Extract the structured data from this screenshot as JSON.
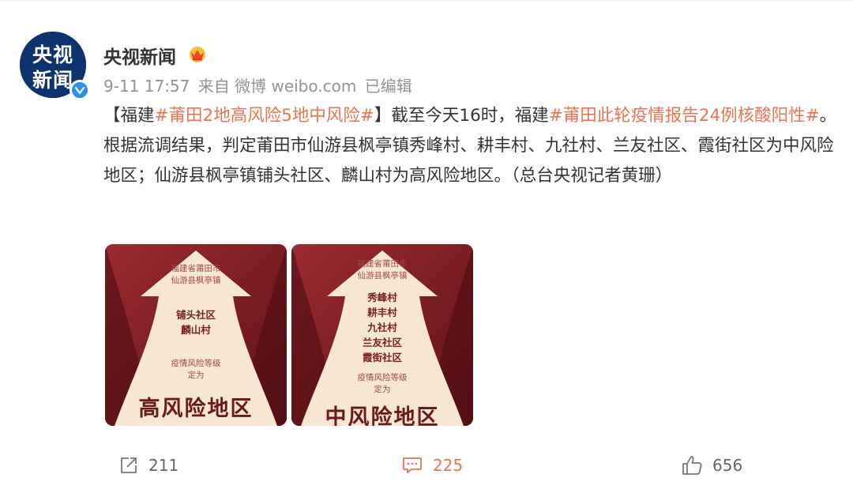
{
  "post": {
    "author": "央视新闻",
    "avatar_line1": "央视",
    "avatar_line2": "新闻",
    "time": "9-11 17:57",
    "source": "来自 微博 weibo.com",
    "edited": "已编辑",
    "text_parts": {
      "p1": "【福建",
      "tag1": "#莆田2地高风险5地中风险#",
      "p2": "】截至今天16时，福建",
      "tag2": "#莆田此轮疫情报告24例核酸阳性#",
      "p3": "。根据流调结果，判定莆田市仙游县枫亭镇秀峰村、耕丰村、九社村、兰友社区、霞街社区为中风险地区；仙游县枫亭镇铺头社区、麟山村为高风险地区。（总台央视记者黄珊）"
    }
  },
  "images": [
    {
      "location_line1": "福建省莆田市",
      "location_line2": "仙游县枫亭镇",
      "names": [
        "铺头社区",
        "麟山村"
      ],
      "level_line1": "疫情风险等级",
      "level_line2": "定为",
      "level": "高风险地区"
    },
    {
      "location_line1": "福建省莆田市",
      "location_line2": "仙游县枫亭镇",
      "names": [
        "秀峰村",
        "耕丰村",
        "九社村",
        "兰友社区",
        "霞街社区"
      ],
      "level_line1": "疫情风险等级",
      "level_line2": "定为",
      "level": "中风险地区"
    }
  ],
  "actions": {
    "repost_count": "211",
    "comment_count": "225",
    "like_count": "656"
  },
  "icons": {
    "verified": "verified-badge-icon",
    "crown": "crown-icon",
    "repost": "repost-icon",
    "comment": "comment-icon",
    "like": "thumbs-up-icon"
  },
  "colors": {
    "tag": "#eb7350",
    "verified": "#2b8ef0",
    "avatar_bg": "#0f336e",
    "card_red": "#8b1e28"
  }
}
